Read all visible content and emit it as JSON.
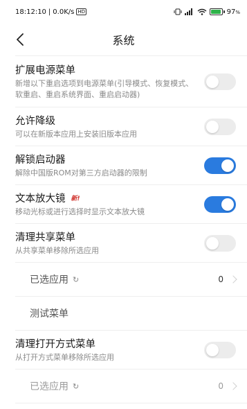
{
  "status": {
    "time": "18:12:10",
    "speed": "0.0K/s",
    "battery": "97",
    "battery_unit": "%",
    "battery_fraction": 0.97,
    "icons": [
      "hd-icon",
      "vibrate-icon",
      "signal-icon",
      "wifi-icon",
      "battery-icon"
    ]
  },
  "header": {
    "title": "系统"
  },
  "settings": [
    {
      "title": "扩展电源菜单",
      "subtitle": "新增以下重启选项到电源菜单(引导模式、恢复模式、软重启、重启系统界面、重启启动器)",
      "on": false
    },
    {
      "title": "允许降级",
      "subtitle": "可以在新版本应用上安装旧版本应用",
      "on": false
    },
    {
      "title": "解锁启动器",
      "subtitle": "解除中国版ROM对第三方启动器的限制",
      "on": true
    },
    {
      "title": "文本放大镜",
      "badge": "新!",
      "subtitle": "移动光标或进行选择时显示文本放大镜",
      "on": true
    },
    {
      "title": "清理共享菜单",
      "subtitle": "从共享菜单移除所选应用",
      "on": false
    },
    {
      "title": "清理打开方式菜单",
      "subtitle": "从打开方式菜单移除所选应用",
      "on": false
    }
  ],
  "share_sub": {
    "selected_apps": "已选应用",
    "selected_count": "0",
    "test_menu": "测试菜单"
  },
  "open_sub": {
    "selected_apps": "已选应用",
    "selected_count": "0"
  },
  "colors": {
    "accent": "#2a7bdf",
    "toggle_off": "#ececec",
    "badge": "#d0322c",
    "battery_fill": "#2fb34a"
  }
}
